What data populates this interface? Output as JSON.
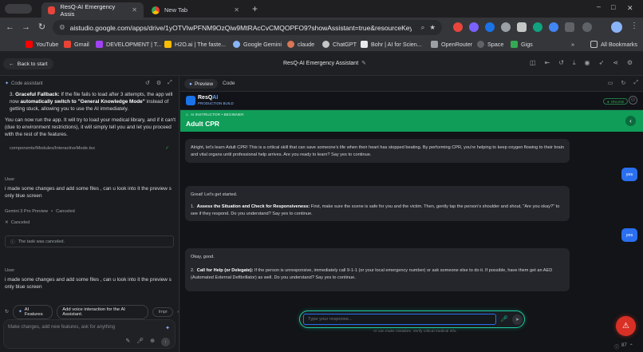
{
  "browser": {
    "tabs": [
      {
        "title": "ResQ-AI Emergency Assis",
        "active": true
      },
      {
        "title": "New Tab",
        "active": false
      }
    ],
    "url": "aistudio.google.com/apps/drive/1yOTVIwPFNM9OzQiw9MtRAcCvCMQOPFO9?showAssistant=true&resourceKey=...",
    "bookmarks": [
      "YouTube",
      "Gmail",
      "DEVELOPMENT | T...",
      "H2O.ai | The faste...",
      "Google Gemini",
      "claude",
      "ChatGPT",
      "Bohr | AI for Scien...",
      "OpenRouter",
      "Space",
      "Gigs"
    ],
    "all_bookmarks": "All Bookmarks"
  },
  "header": {
    "back": "Back to start",
    "title": "ResQ-AI Emergency Assistant"
  },
  "assistant": {
    "label": "Code assistant",
    "fallback_item": "3.",
    "fallback_title": "Graceful Fallback:",
    "fallback_text_1": " If the file fails to load after 3 attempts, the app will now ",
    "fallback_bold": "automatically switch to \"General Knowledge Mode\"",
    "fallback_text_2": " instead of getting stuck, allowing you to use the AI immediately.",
    "summary": "You can now run the app. It will try to load your medical library, and if it can't (due to environment restrictions), it will simply tell you and let you proceed with the rest of the features.",
    "file": "components/Modules/InteractiveMode.tsx",
    "user_label": "User",
    "user_msg": "i made some changes and add some files , can u look into it the preview s only blue screen",
    "model": "Gemini 3 Pro Preview",
    "model_status": "Canceled",
    "task_canceled": "The task was canceled.",
    "canceled": "Canceled",
    "user_label2": "User",
    "user_msg2": "i made some changes and add some files , can u look into it the preview s only blue screen",
    "chips": [
      "AI Features",
      "Add voice interaction for the AI Assistant.",
      "Impr"
    ],
    "input_placeholder": "Make changes, add new features, ask for anything"
  },
  "preview": {
    "tab_preview": "Preview",
    "tab_code": "Code",
    "app_name_1": "ResQ",
    "app_name_2": "AI",
    "build": "PRODUCTION BUILD",
    "online": "ONLINE",
    "banner_sub": "AI INSTRUCTOR • BEGINNER",
    "banner_title": "Adult CPR",
    "msg1": "Alright, let's learn Adult CPR! This is a critical skill that can save someone's life when their heart has stopped beating. By performing CPR, you're helping to keep oxygen flowing to their brain and vital organs until professional help arrives. Are you ready to learn? Say yes to continue.",
    "reply1": "yes",
    "msg2_intro": "Great! Let's get started.",
    "msg2_num": "1.",
    "msg2_bold": "Assess the Situation and Check for Responsiveness:",
    "msg2_text": " First, make sure the scene is safe for you and the victim. Then, gently tap the person's shoulder and shout, \"Are you okay?\" to see if they respond. Do you understand? Say yes to continue.",
    "reply2": "yes",
    "msg3_intro": "Okay, good.",
    "msg3_num": "2.",
    "msg3_bold": "Call for Help (or Delegate):",
    "msg3_text": " If the person is unresponsive, immediately call 9-1-1 (or your local emergency number) or ask someone else to do it. If possible, have them get an AED (Automated External Defibrillator) as well. Do you understand? Say yes to continue.",
    "input_placeholder": "Type your response...",
    "disclaimer": "AI can make mistakes. Verify critical medical info.",
    "counter": "87"
  }
}
